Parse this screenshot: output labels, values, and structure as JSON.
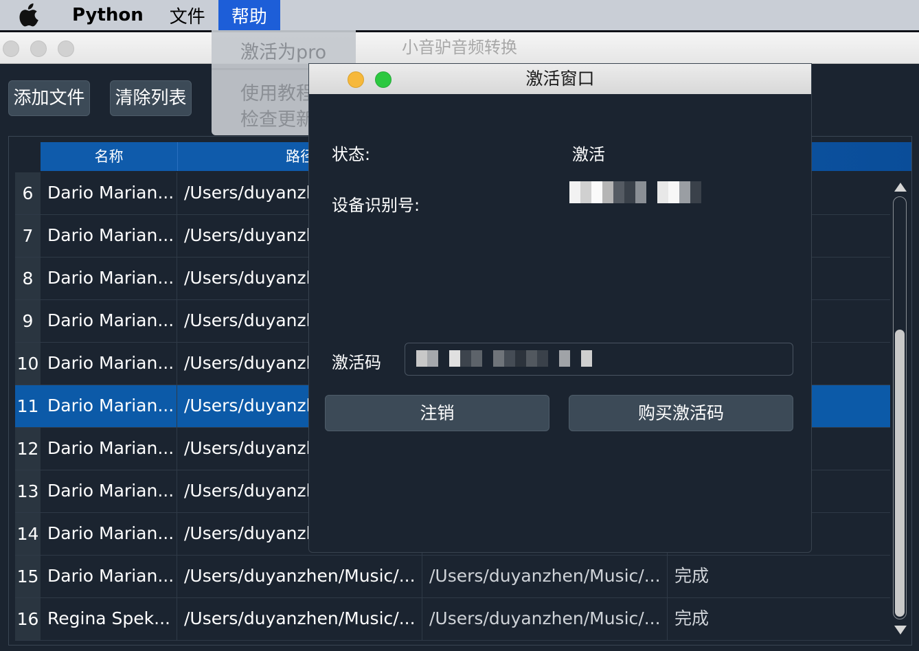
{
  "menubar": {
    "items": [
      "Python",
      "文件",
      "帮助"
    ],
    "active_index": 2
  },
  "window": {
    "title": "小音驴音频转换"
  },
  "toolbar": {
    "add_files_label": "添加文件",
    "clear_list_label": "清除列表"
  },
  "table": {
    "headers": [
      "名称",
      "路径"
    ],
    "rows": [
      {
        "index": "6",
        "name": "Dario Marian...",
        "path": "/Users/duyanzh",
        "output": "",
        "status": ""
      },
      {
        "index": "7",
        "name": "Dario Marian...",
        "path": "/Users/duyanzh",
        "output": "",
        "status": ""
      },
      {
        "index": "8",
        "name": "Dario Marian...",
        "path": "/Users/duyanzh",
        "output": "",
        "status": ""
      },
      {
        "index": "9",
        "name": "Dario Marian...",
        "path": "/Users/duyanzh",
        "output": "",
        "status": ""
      },
      {
        "index": "10",
        "name": "Dario Marian...",
        "path": "/Users/duyanzh",
        "output": "",
        "status": ""
      },
      {
        "index": "11",
        "name": "Dario Marian...",
        "path": "/Users/duyanzh",
        "output": "",
        "status": ""
      },
      {
        "index": "12",
        "name": "Dario Marian...",
        "path": "/Users/duyanzh",
        "output": "",
        "status": ""
      },
      {
        "index": "13",
        "name": "Dario Marian...",
        "path": "/Users/duyanzh",
        "output": "",
        "status": ""
      },
      {
        "index": "14",
        "name": "Dario Marian...",
        "path": "/Users/duyanzh",
        "output": "",
        "status": ""
      },
      {
        "index": "15",
        "name": "Dario Marian...",
        "path": "/Users/duyanzhen/Music/...",
        "output": "/Users/duyanzhen/Music/...",
        "status": "完成"
      },
      {
        "index": "16",
        "name": "Regina Spek...",
        "path": "/Users/duyanzhen/Music/...",
        "output": "/Users/duyanzhen/Music/...",
        "status": "完成"
      }
    ],
    "selected_index": "11"
  },
  "help_menu": {
    "items": [
      "激活为pro",
      "使用教程",
      "检查更新"
    ]
  },
  "dialog": {
    "title": "激活窗口",
    "status_label": "状态:",
    "status_value": "激活",
    "device_id_label": "设备识别号:",
    "code_label": "激活码",
    "logout_label": "注销",
    "buy_label": "购买激活码"
  },
  "colors": {
    "background": "#1b2430",
    "header_blue": "#0f5bab",
    "selected_row": "#0c5aa8",
    "button": "#3c4a57",
    "menu_active": "#1d5ed8"
  },
  "icons": [
    "apple-icon",
    "scroll-up-arrow-icon",
    "scroll-down-arrow-icon"
  ]
}
